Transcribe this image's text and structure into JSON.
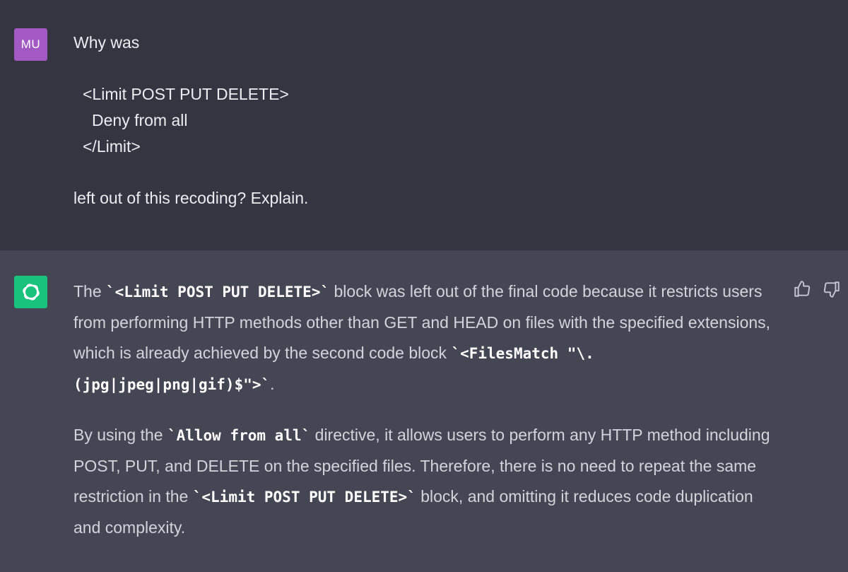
{
  "user_message": {
    "avatar_initials": "MU",
    "line_1": "Why was",
    "code_line_1": "<Limit POST PUT DELETE>",
    "code_line_2": "Deny from all",
    "code_line_3": "</Limit>",
    "line_last": "left out of this recoding? Explain."
  },
  "assistant_message": {
    "p1_a": "The ",
    "p1_code1": "`<Limit POST PUT DELETE>`",
    "p1_b": " block was left out of the final code because it restricts users from performing HTTP methods other than GET and HEAD on files with the specified extensions, which is already achieved by the second code block ",
    "p1_code2": "`<FilesMatch \"\\.(jpg|jpeg|png|gif)$\">`",
    "p1_c": ".",
    "p2_a": "By using the ",
    "p2_code1": "`Allow from all`",
    "p2_b": " directive, it allows users to perform any HTTP method including POST, PUT, and DELETE on the specified files. Therefore, there is no need to repeat the same restriction in the ",
    "p2_code2": "`<Limit POST PUT DELETE>`",
    "p2_c": " block, and omitting it reduces code duplication and complexity."
  },
  "icons": {
    "assistant_avatar": "openai-logo-icon",
    "like": "thumbs-up-icon",
    "dislike": "thumbs-down-icon"
  },
  "colors": {
    "user_bg": "#343541",
    "assistant_bg": "#444654",
    "user_avatar": "#a259c4",
    "assistant_avatar": "#19c37d"
  }
}
